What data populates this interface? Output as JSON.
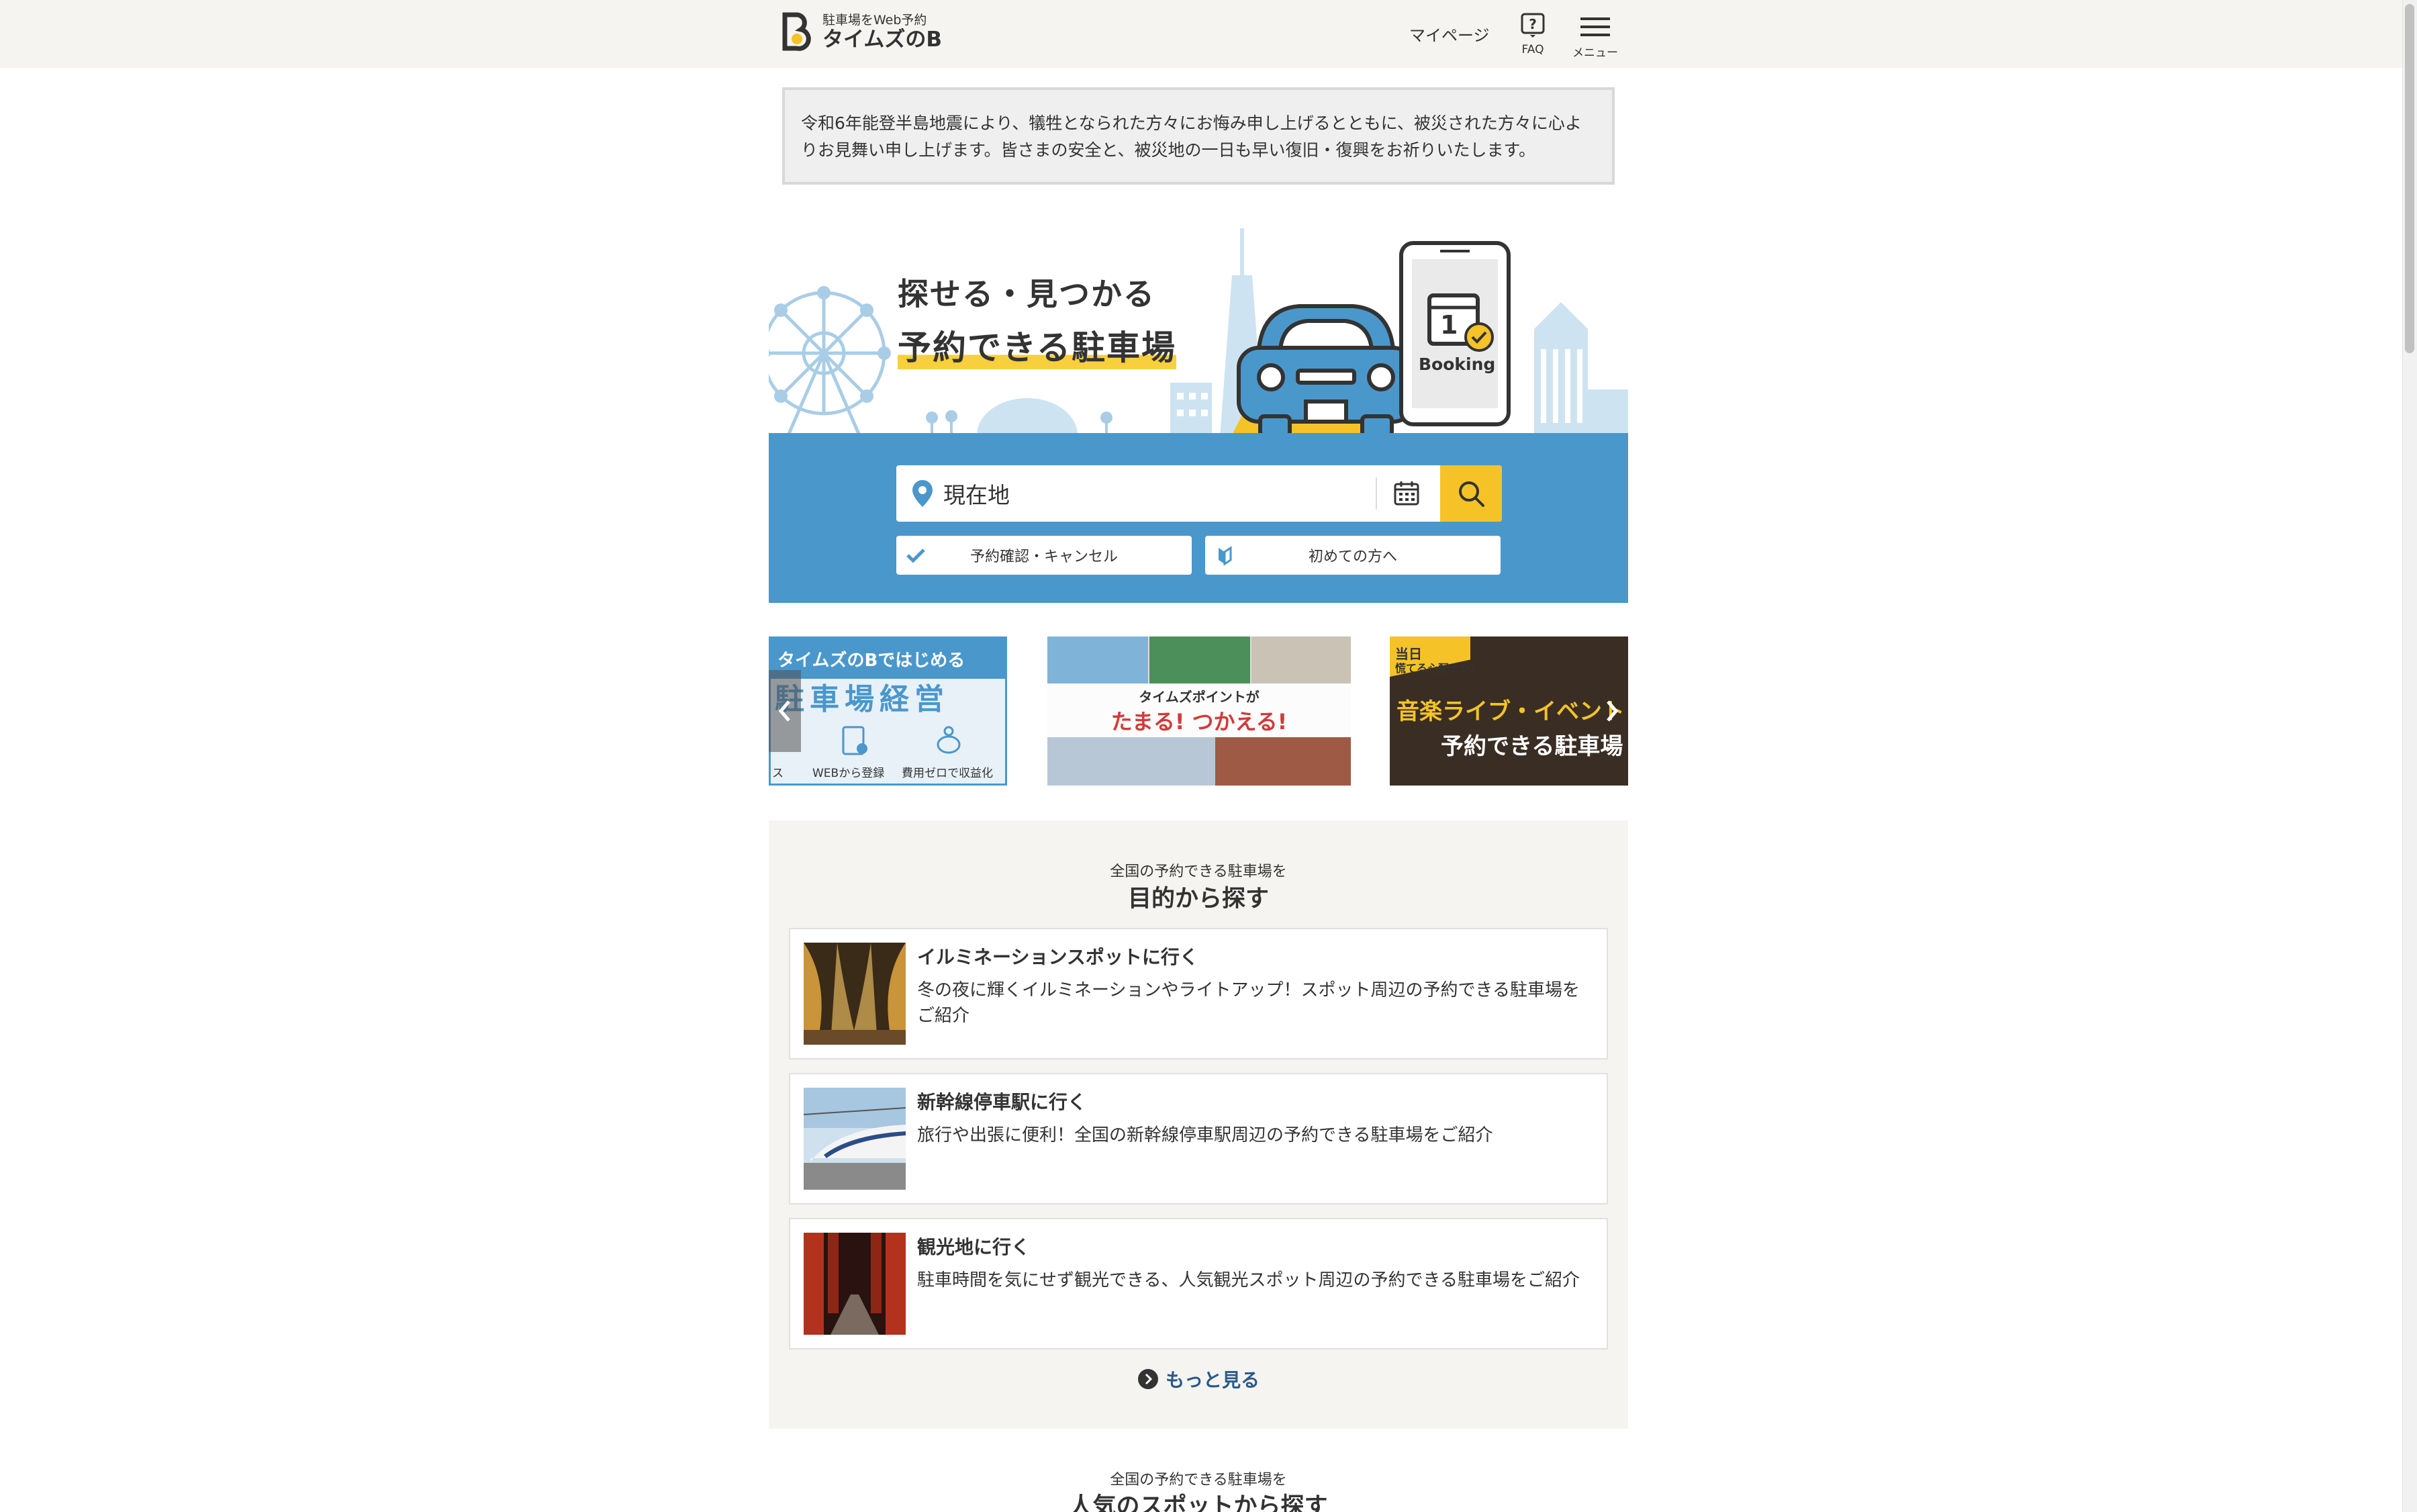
{
  "header": {
    "logo_sub": "駐車場をWeb予約",
    "logo_main": "タイムズのB",
    "mypage": "マイページ",
    "faq": "FAQ",
    "menu": "メニュー"
  },
  "notice": {
    "text": "令和6年能登半島地震により、犠牲となられた方々にお悔み申し上げるとともに、被災された方々に心よりお見舞い申し上げます。皆さまの安全と、被災地の一日も早い復旧・復興をお祈りいたします。"
  },
  "hero": {
    "title_line1": "探せる・見つかる",
    "title_line2": "予約できる駐車場",
    "phone_date": "1",
    "phone_label": "Booking",
    "search_value": "現在地",
    "reserve_check": "予約確認・キャンセル",
    "first_time": "初めての方へ"
  },
  "banners": {
    "b1_line1": "タイムズのBではじめる",
    "b1_line2": "駐車場経営",
    "b1_item1": "ス",
    "b1_item2": "WEBから登録",
    "b1_item3": "費用ゼロで収益化",
    "b2_line1": "タイムズポイントが",
    "b2_line2": "たまる! つかえる!",
    "b3_tag1": "当日",
    "b3_tag2": "慌てる心配ナシ!",
    "b3_line1": "音楽ライブ・イベント",
    "b3_line2": "予約できる駐車場"
  },
  "purpose": {
    "subtitle": "全国の予約できる駐車場を",
    "title": "目的から探す",
    "cards": [
      {
        "title": "イルミネーションスポットに行く",
        "desc": "冬の夜に輝くイルミネーションやライトアップ！スポット周辺の予約できる駐車場をご紹介"
      },
      {
        "title": "新幹線停車駅に行く",
        "desc": "旅行や出張に便利！全国の新幹線停車駅周辺の予約できる駐車場をご紹介"
      },
      {
        "title": "観光地に行く",
        "desc": "駐車時間を気にせず観光できる、人気観光スポット周辺の予約できる駐車場をご紹介"
      }
    ],
    "more": "もっと見る"
  },
  "popular": {
    "subtitle": "全国の予約できる駐車場を",
    "title": "人気のスポットから探す"
  },
  "colors": {
    "brand_blue": "#4a97cc",
    "accent_yellow": "#f5c327",
    "link": "#2a5a8a"
  }
}
